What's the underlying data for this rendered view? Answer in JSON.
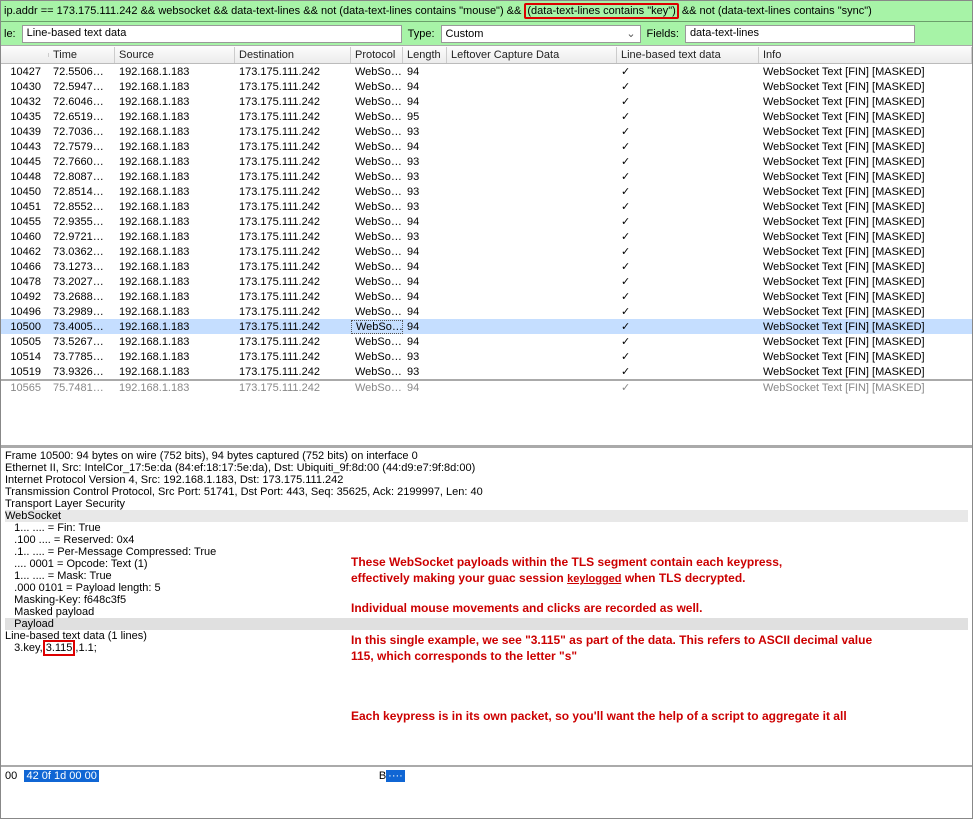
{
  "filter": {
    "pre": "ip.addr == 173.175.111.242 && websocket && data-text-lines && not (data-text-lines contains \"mouse\") && ",
    "highlight": "(data-text-lines contains \"key\")",
    "post": " && not (data-text-lines contains \"sync\")"
  },
  "bar2": {
    "label_le": "le:",
    "line_input": "Line-based text data",
    "type_label": "Type:",
    "type_value": "Custom",
    "fields_label": "Fields:",
    "fields_value": "data-text-lines"
  },
  "columns": {
    "no": "",
    "time": "Time",
    "src": "Source",
    "dst": "Destination",
    "proto": "Protocol",
    "len": "Length",
    "left": "Leftover Capture Data",
    "line": "Line-based text data",
    "info": "Info"
  },
  "rows": [
    {
      "no": "10427",
      "time": "72.5506…",
      "src": "192.168.1.183",
      "dst": "173.175.111.242",
      "proto": "WebSo…",
      "len": "94",
      "info": "WebSocket Text [FIN] [MASKED]"
    },
    {
      "no": "10430",
      "time": "72.5947…",
      "src": "192.168.1.183",
      "dst": "173.175.111.242",
      "proto": "WebSo…",
      "len": "94",
      "info": "WebSocket Text [FIN] [MASKED]"
    },
    {
      "no": "10432",
      "time": "72.6046…",
      "src": "192.168.1.183",
      "dst": "173.175.111.242",
      "proto": "WebSo…",
      "len": "94",
      "info": "WebSocket Text [FIN] [MASKED]"
    },
    {
      "no": "10435",
      "time": "72.6519…",
      "src": "192.168.1.183",
      "dst": "173.175.111.242",
      "proto": "WebSo…",
      "len": "95",
      "info": "WebSocket Text [FIN] [MASKED]"
    },
    {
      "no": "10439",
      "time": "72.7036…",
      "src": "192.168.1.183",
      "dst": "173.175.111.242",
      "proto": "WebSo…",
      "len": "93",
      "info": "WebSocket Text [FIN] [MASKED]"
    },
    {
      "no": "10443",
      "time": "72.7579…",
      "src": "192.168.1.183",
      "dst": "173.175.111.242",
      "proto": "WebSo…",
      "len": "94",
      "info": "WebSocket Text [FIN] [MASKED]"
    },
    {
      "no": "10445",
      "time": "72.7660…",
      "src": "192.168.1.183",
      "dst": "173.175.111.242",
      "proto": "WebSo…",
      "len": "93",
      "info": "WebSocket Text [FIN] [MASKED]"
    },
    {
      "no": "10448",
      "time": "72.8087…",
      "src": "192.168.1.183",
      "dst": "173.175.111.242",
      "proto": "WebSo…",
      "len": "93",
      "info": "WebSocket Text [FIN] [MASKED]"
    },
    {
      "no": "10450",
      "time": "72.8514…",
      "src": "192.168.1.183",
      "dst": "173.175.111.242",
      "proto": "WebSo…",
      "len": "93",
      "info": "WebSocket Text [FIN] [MASKED]"
    },
    {
      "no": "10451",
      "time": "72.8552…",
      "src": "192.168.1.183",
      "dst": "173.175.111.242",
      "proto": "WebSo…",
      "len": "93",
      "info": "WebSocket Text [FIN] [MASKED]"
    },
    {
      "no": "10455",
      "time": "72.9355…",
      "src": "192.168.1.183",
      "dst": "173.175.111.242",
      "proto": "WebSo…",
      "len": "94",
      "info": "WebSocket Text [FIN] [MASKED]"
    },
    {
      "no": "10460",
      "time": "72.9721…",
      "src": "192.168.1.183",
      "dst": "173.175.111.242",
      "proto": "WebSo…",
      "len": "93",
      "info": "WebSocket Text [FIN] [MASKED]"
    },
    {
      "no": "10462",
      "time": "73.0362…",
      "src": "192.168.1.183",
      "dst": "173.175.111.242",
      "proto": "WebSo…",
      "len": "94",
      "info": "WebSocket Text [FIN] [MASKED]"
    },
    {
      "no": "10466",
      "time": "73.1273…",
      "src": "192.168.1.183",
      "dst": "173.175.111.242",
      "proto": "WebSo…",
      "len": "94",
      "info": "WebSocket Text [FIN] [MASKED]"
    },
    {
      "no": "10478",
      "time": "73.2027…",
      "src": "192.168.1.183",
      "dst": "173.175.111.242",
      "proto": "WebSo…",
      "len": "94",
      "info": "WebSocket Text [FIN] [MASKED]"
    },
    {
      "no": "10492",
      "time": "73.2688…",
      "src": "192.168.1.183",
      "dst": "173.175.111.242",
      "proto": "WebSo…",
      "len": "94",
      "info": "WebSocket Text [FIN] [MASKED]"
    },
    {
      "no": "10496",
      "time": "73.2989…",
      "src": "192.168.1.183",
      "dst": "173.175.111.242",
      "proto": "WebSo…",
      "len": "94",
      "info": "WebSocket Text [FIN] [MASKED]"
    },
    {
      "no": "10500",
      "time": "73.4005…",
      "src": "192.168.1.183",
      "dst": "173.175.111.242",
      "proto": "WebSo…",
      "len": "94",
      "info": "WebSocket Text [FIN] [MASKED]",
      "sel": true
    },
    {
      "no": "10505",
      "time": "73.5267…",
      "src": "192.168.1.183",
      "dst": "173.175.111.242",
      "proto": "WebSo…",
      "len": "94",
      "info": "WebSocket Text [FIN] [MASKED]"
    },
    {
      "no": "10514",
      "time": "73.7785…",
      "src": "192.168.1.183",
      "dst": "173.175.111.242",
      "proto": "WebSo…",
      "len": "93",
      "info": "WebSocket Text [FIN] [MASKED]"
    },
    {
      "no": "10519",
      "time": "73.9326…",
      "src": "192.168.1.183",
      "dst": "173.175.111.242",
      "proto": "WebSo…",
      "len": "93",
      "info": "WebSocket Text [FIN] [MASKED]"
    },
    {
      "no": "10565",
      "time": "75.7481…",
      "src": "192.168.1.183",
      "dst": "173.175.111.242",
      "proto": "WebSo…",
      "len": "94",
      "info": "WebSocket Text [FIN] [MASKED]",
      "cut": true
    }
  ],
  "detail": {
    "lines": [
      "Frame 10500: 94 bytes on wire (752 bits), 94 bytes captured (752 bits) on interface 0",
      "Ethernet II, Src: IntelCor_17:5e:da (84:ef:18:17:5e:da), Dst: Ubiquiti_9f:8d:00 (44:d9:e7:9f:8d:00)",
      "Internet Protocol Version 4, Src: 192.168.1.183, Dst: 173.175.111.242",
      "Transmission Control Protocol, Src Port: 51741, Dst Port: 443, Seq: 35625, Ack: 2199997, Len: 40",
      "Transport Layer Security",
      "WebSocket",
      "   1... .... = Fin: True",
      "   .100 .... = Reserved: 0x4",
      "   .1.. .... = Per-Message Compressed: True",
      "   .... 0001 = Opcode: Text (1)",
      "   1... .... = Mask: True",
      "   .000 0101 = Payload length: 5",
      "   Masking-Key: f648c3f5",
      "   Masked payload",
      "   Payload",
      "Line-based text data (1 lines)",
      "   3.key,3.115,1.1;"
    ],
    "payload_idx": 14,
    "keydata_idx": 16,
    "keydata_pre": "   3.key,",
    "keydata_box": "3.115",
    "keydata_post": ",1.1;"
  },
  "anno": {
    "p1a": "These WebSocket payloads within the TLS segment contain each keypress,",
    "p1b": "effectively making your guac session ",
    "p1u": "keylogged",
    "p1c": " when TLS decrypted.",
    "p2": "Individual mouse movements and clicks are recorded as well.",
    "p3a": "In this single example, we see \"3.115\" as part of the data. This refers to ASCII decimal value",
    "p3b": "115, which corresponds to the letter \"s\"",
    "p4": "Each keypress is in its own packet, so you'll want the help of a script to aggregate it all"
  },
  "hex": {
    "offset": "00",
    "sel": "42 0f 1d 00 00",
    "dots_pre": "B",
    "dots_sel": "····"
  }
}
